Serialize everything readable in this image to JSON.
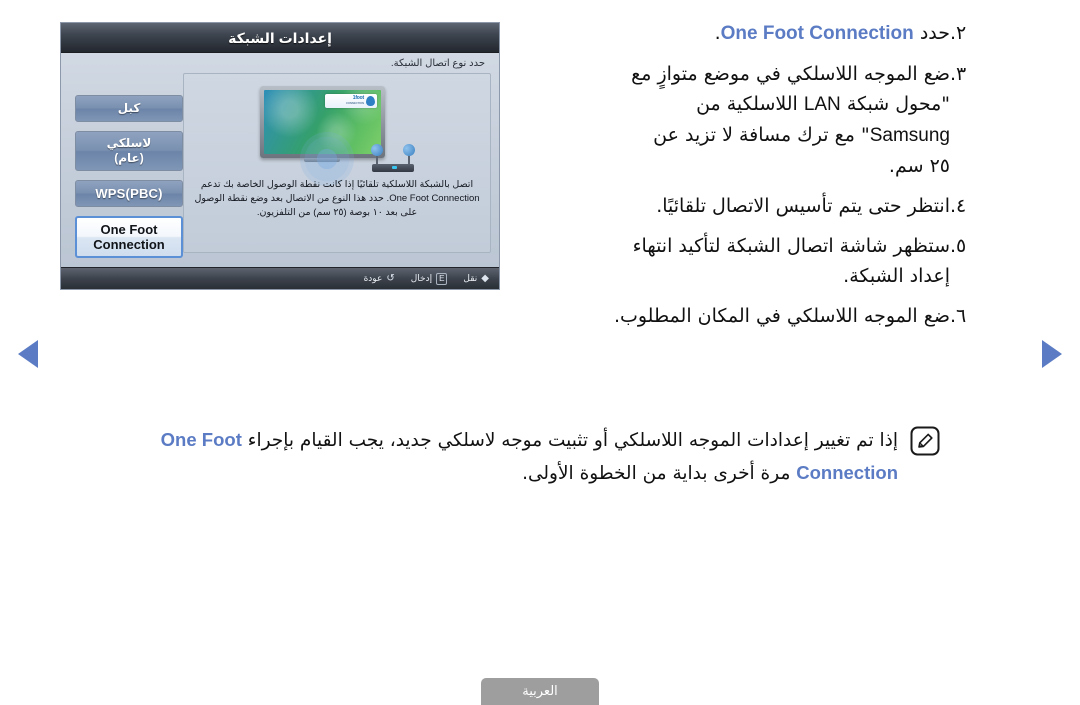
{
  "osd": {
    "title": "إعدادات الشبكة",
    "subtitle": "حدد نوع اتصال الشبكة.",
    "options": [
      {
        "label": "كبل",
        "selected": false
      },
      {
        "label": "لاسلكي\n(عام)",
        "selected": false
      },
      {
        "label": "WPS(PBC)",
        "selected": false
      },
      {
        "label": "One Foot\nConnection",
        "selected": true
      }
    ],
    "option_labels": {
      "cable": "كبل",
      "wireless_line1": "لاسلكي",
      "wireless_line2": "(عام)",
      "wps": "WPS(PBC)",
      "ofc_line1": "One Foot",
      "ofc_line2": "Connection"
    },
    "description": "اتصل بالشبكة اللاسلكية تلقائيًا إذا كانت نقطة الوصول الخاصة بك تدعم One Foot Connection. حدد هذا النوع من الاتصال بعد وضع نقطة الوصول على بعد ١٠ بوصة (٢٥ سم) من التلفزيون.",
    "footer": {
      "move_key": "◆",
      "move_label": "نقل",
      "enter_key": "E",
      "enter_label": "إدخال",
      "return_key": "↺",
      "return_label": "عودة"
    },
    "badge": {
      "title": "1foot",
      "subtitle": "CONNECTION"
    }
  },
  "steps": [
    {
      "num": "٢.",
      "pre": "",
      "highlight": "One Foot Connection",
      "post": " حدد",
      "tail": "."
    },
    {
      "num": "٣.",
      "line1": "ضع الموجه اللاسلكي في موضع متوازٍ مع",
      "line2_a": "\"محول شبكة ",
      "line2_latin": "LAN",
      "line2_b": " اللاسلكية من",
      "line3_latin": "Samsung",
      "line3_b": "\" مع ترك مسافة لا تزيد عن",
      "line4": "٢٥ سم."
    },
    {
      "num": "٤.",
      "text": "انتظر حتى يتم تأسيس الاتصال تلقائيًا."
    },
    {
      "num": "٥.",
      "line1": "ستظهر شاشة اتصال الشبكة لتأكيد انتهاء",
      "line2": "إعداد الشبكة."
    },
    {
      "num": "٦.",
      "text": "ضع الموجه اللاسلكي في المكان المطلوب."
    }
  ],
  "note": {
    "icon": "note-pencil-icon",
    "line1": "إذا تم تغيير إعدادات الموجه اللاسلكي أو تثبيت موجه لاسلكي جديد، يجب القيام بإجراء",
    "highlight": "One Foot Connection",
    "line2_tail": " مرة أخرى بداية من الخطوة الأولى."
  },
  "nav": {
    "prev_label": "prev-page-arrow",
    "next_label": "next-page-arrow"
  },
  "language_tab": {
    "label": "العربية"
  },
  "colors": {
    "accent_blue": "#5b7cc4",
    "osd_header_dark": "#23272e",
    "osd_button_blue": "#7a90b0",
    "selected_border": "#5b8fd6",
    "lang_tab_gray": "#9e9e9e"
  }
}
